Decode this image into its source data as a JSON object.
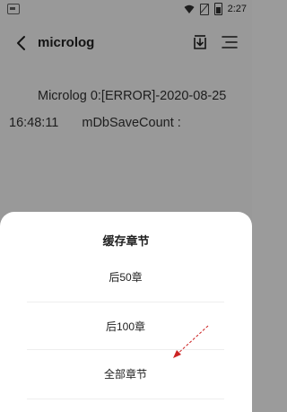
{
  "status_bar": {
    "time": "2:27"
  },
  "toolbar": {
    "title": "microlog",
    "icons": [
      "back-arrow-icon",
      "download-icon",
      "list-menu-icon"
    ]
  },
  "log": {
    "line1": "Microlog 0:[ERROR]-2020-08-25",
    "line2_time": "16:48:11",
    "line2_text": "mDbSaveCount :"
  },
  "sheet": {
    "title": "缓存章节",
    "options": [
      {
        "label": "后50章"
      },
      {
        "label": "后100章"
      },
      {
        "label": "全部章节"
      }
    ]
  },
  "colors": {
    "annotation_arrow": "#cc2222",
    "overlay": "rgba(0,0,0,0.40)"
  }
}
